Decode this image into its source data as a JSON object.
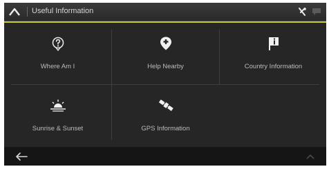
{
  "header": {
    "title": "Useful Information",
    "icons": [
      "up-arrow-icon",
      "tools-icon",
      "chat-icon"
    ]
  },
  "menu": {
    "items": [
      {
        "label": "Where Am I",
        "icon": "location-question-icon"
      },
      {
        "label": "Help Nearby",
        "icon": "help-pin-icon"
      },
      {
        "label": "Country Information",
        "icon": "country-info-flag-icon"
      },
      {
        "label": "Sunrise & Sunset",
        "icon": "sunrise-icon"
      },
      {
        "label": "GPS Information",
        "icon": "satellite-icon"
      }
    ]
  },
  "footer": {
    "icons": [
      "back-arrow-icon",
      "more-icon"
    ]
  },
  "colors": {
    "accent": "#c5cc2e",
    "background": "#262626",
    "bar": "#2e2e2e",
    "text": "#bdbdbd"
  }
}
